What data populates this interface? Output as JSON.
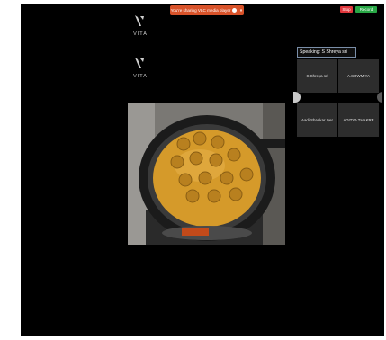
{
  "banner": {
    "text": "You're sharing VLC media player"
  },
  "buttons": {
    "stop": "Stop",
    "record": "Record"
  },
  "logos": [
    {
      "text": "VITA"
    },
    {
      "text": "VITA"
    }
  ],
  "speaking": {
    "text": "Speaking: S Shreya sri"
  },
  "participants": [
    {
      "name": "S Shreya sri"
    },
    {
      "name": "A.SOWMIYA"
    },
    {
      "name": "Aadi Shankar Iyer"
    },
    {
      "name": "ADITYA THAKRE"
    }
  ],
  "colors": {
    "banner": "#d9532a",
    "stop": "#e0373c",
    "record": "#29a846",
    "tile": "#2d2d2d"
  }
}
